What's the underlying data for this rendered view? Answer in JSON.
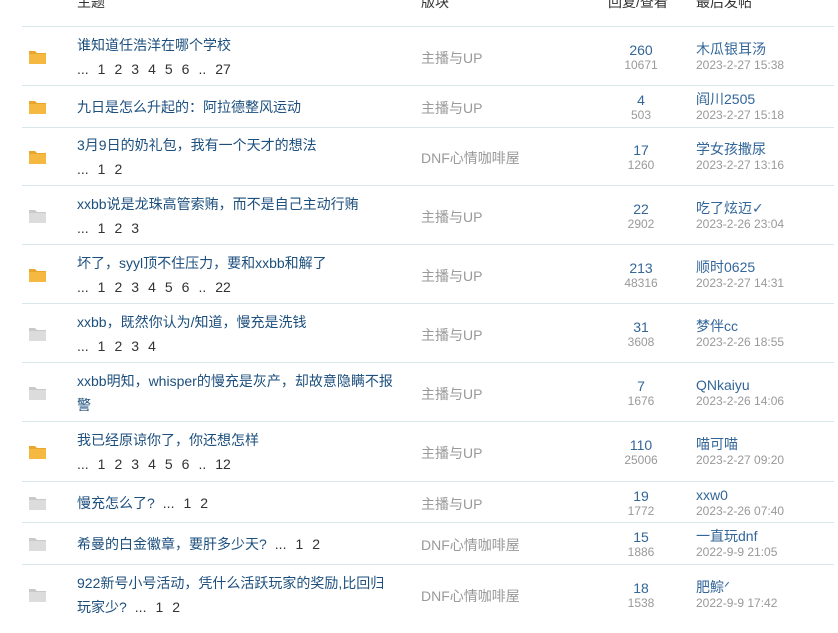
{
  "header": {
    "topic": "主题",
    "section": "版块",
    "reply_view": "回复/查看",
    "last_post": "最后发帖"
  },
  "colors": {
    "folder_hot": "#f5b942",
    "folder_normal": "#dcdcdc",
    "link": "#336699"
  },
  "rows": [
    {
      "icon": "folder-hot-icon",
      "title": "谁知道任浩洋在哪个学校",
      "pages": [
        "...",
        "1",
        "2",
        "3",
        "4",
        "5",
        "6",
        "..",
        "27"
      ],
      "section": "主播与UP",
      "replies": "260",
      "views": "10671",
      "last_user": "木瓜银耳汤",
      "last_time": "2023-2-27 15:38"
    },
    {
      "icon": "folder-hot-icon",
      "title": "九日是怎么升起的：阿拉德整风运动",
      "pages": [],
      "section": "主播与UP",
      "replies": "4",
      "views": "503",
      "last_user": "阎川2505",
      "last_time": "2023-2-27 15:18"
    },
    {
      "icon": "folder-hot-icon",
      "title": "3月9日的奶礼包，我有一个天才的想法",
      "pages": [
        "...",
        "1",
        "2"
      ],
      "section": "DNF心情咖啡屋",
      "replies": "17",
      "views": "1260",
      "last_user": "学女孩撒尿",
      "last_time": "2023-2-27 13:16"
    },
    {
      "icon": "folder-normal-icon",
      "title": "xxbb说是龙珠高管索贿，而不是自己主动行贿",
      "pages": [
        "...",
        "1",
        "2",
        "3"
      ],
      "section": "主播与UP",
      "replies": "22",
      "views": "2902",
      "last_user": "吃了炫迈✓",
      "last_time": "2023-2-26 23:04"
    },
    {
      "icon": "folder-hot-icon",
      "title": "坏了，syyl顶不住压力，要和xxbb和解了",
      "pages": [
        "...",
        "1",
        "2",
        "3",
        "4",
        "5",
        "6",
        "..",
        "22"
      ],
      "section": "主播与UP",
      "replies": "213",
      "views": "48316",
      "last_user": "顺时0625",
      "last_time": "2023-2-27 14:31"
    },
    {
      "icon": "folder-normal-icon",
      "title": "xxbb，既然你认为/知道，慢充是洗钱",
      "pages": [
        "...",
        "1",
        "2",
        "3",
        "4"
      ],
      "section": "主播与UP",
      "replies": "31",
      "views": "3608",
      "last_user": "梦伴cc",
      "last_time": "2023-2-26 18:55"
    },
    {
      "icon": "folder-normal-icon",
      "title": "xxbb明知，whisper的慢充是灰产，却故意隐瞒不报警",
      "pages": [],
      "section": "主播与UP",
      "replies": "7",
      "views": "1676",
      "last_user": "QNkaiyu",
      "last_time": "2023-2-26 14:06"
    },
    {
      "icon": "folder-hot-icon",
      "title": "我已经原谅你了，你还想怎样",
      "pages": [
        "...",
        "1",
        "2",
        "3",
        "4",
        "5",
        "6",
        "..",
        "12"
      ],
      "section": "主播与UP",
      "replies": "110",
      "views": "25006",
      "last_user": "喵可喵",
      "last_time": "2023-2-27 09:20"
    },
    {
      "icon": "folder-normal-icon",
      "title": "慢充怎么了?",
      "pages": [
        "...",
        "1",
        "2"
      ],
      "inline_pages": true,
      "section": "主播与UP",
      "replies": "19",
      "views": "1772",
      "last_user": "xxw0",
      "last_time": "2023-2-26 07:40"
    },
    {
      "icon": "folder-normal-icon",
      "title": "希曼的白金徽章，要肝多少天?",
      "pages": [
        "...",
        "1",
        "2"
      ],
      "inline_pages": true,
      "section": "DNF心情咖啡屋",
      "replies": "15",
      "views": "1886",
      "last_user": "一直玩dnf",
      "last_time": "2022-9-9 21:05"
    },
    {
      "icon": "folder-normal-icon",
      "title": "922新号小号活动，凭什么活跃玩家的奖励,比回归玩家少?",
      "pages": [
        "...",
        "1",
        "2"
      ],
      "inline_pages": true,
      "section": "DNF心情咖啡屋",
      "replies": "18",
      "views": "1538",
      "last_user": "肥鯮ᐟ",
      "last_time": "2022-9-9 17:42"
    }
  ]
}
